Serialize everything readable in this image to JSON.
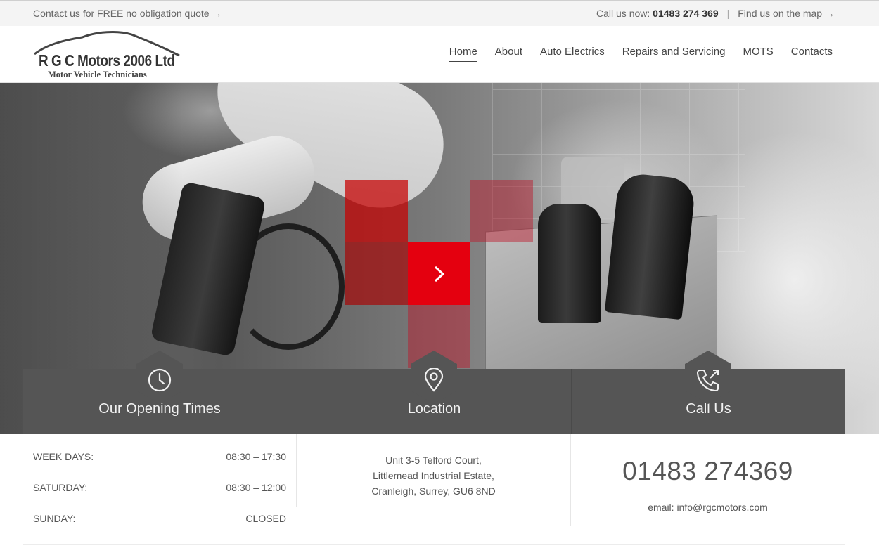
{
  "topbar": {
    "quote_text": "Contact us for FREE no obligation quote →",
    "call_label": "Call us now:",
    "call_number": "01483 274 369",
    "separator": "|",
    "map_text": "Find us on the map →"
  },
  "logo": {
    "name": "R G C Motors 2006 Ltd",
    "tagline": "Motor Vehicle Technicians"
  },
  "nav": {
    "items": [
      {
        "label": "Home",
        "active": true
      },
      {
        "label": "About"
      },
      {
        "label": "Auto Electrics"
      },
      {
        "label": "Repairs and Servicing"
      },
      {
        "label": "MOTS"
      },
      {
        "label": "Contacts"
      }
    ]
  },
  "hero": {
    "accent_color": "#e4000f",
    "play_icon": "chevron-right-icon"
  },
  "opening_times": {
    "title": "Our Opening Times",
    "icon": "clock-icon",
    "rows": [
      {
        "day": "WEEK DAYS:",
        "hours": "08:30 – 17:30"
      },
      {
        "day": "SATURDAY:",
        "hours": "08:30 – 12:00"
      },
      {
        "day": "SUNDAY:",
        "hours": "CLOSED"
      }
    ]
  },
  "location": {
    "title": "Location",
    "icon": "map-pin-icon",
    "address_line1": "Unit 3-5 Telford Court,",
    "address_line2": "Littlemead Industrial Estate,",
    "address_line3": "Cranleigh, Surrey, GU6 8ND"
  },
  "call_us": {
    "title": "Call Us",
    "icon": "phone-outgoing-icon",
    "phone": "01483 274369",
    "email": "email: info@rgcmotors.com"
  },
  "colors": {
    "panel": "#555555",
    "topbar": "#f4f4f4",
    "accent": "#e4000f"
  }
}
